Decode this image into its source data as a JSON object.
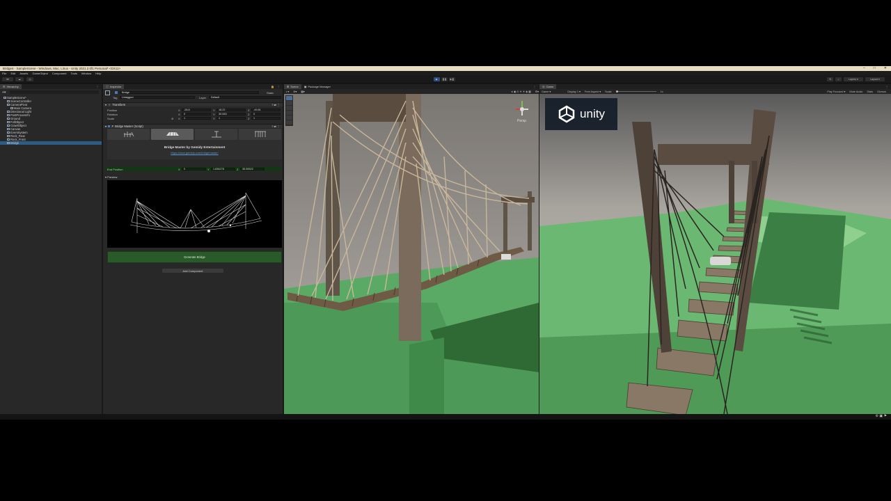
{
  "window": {
    "title": "Bridge4 - SampleScene - Windows, Mac, Linux - Unity 2021.2.0f1 Personal* <DX11>"
  },
  "menu": [
    "File",
    "Edit",
    "Assets",
    "GameObject",
    "Component",
    "Tools",
    "Window",
    "Help"
  ],
  "toolbar": {
    "layers": "Layers",
    "layout": "Layout"
  },
  "hierarchy": {
    "tab": "Hierarchy",
    "items": [
      {
        "label": "SampleScene*",
        "indent": 0
      },
      {
        "label": "SceneController",
        "indent": 1
      },
      {
        "label": "CameraPivot",
        "indent": 1
      },
      {
        "label": "Main Camera",
        "indent": 2
      },
      {
        "label": "Directional Light",
        "indent": 1
      },
      {
        "label": "PostProcessFx",
        "indent": 1
      },
      {
        "label": "Ground",
        "indent": 1
      },
      {
        "label": "FollObject",
        "indent": 1
      },
      {
        "label": "CrawlObject",
        "indent": 1
      },
      {
        "label": "Canvas",
        "indent": 1
      },
      {
        "label": "EventSystem",
        "indent": 1
      },
      {
        "label": "Rock_Rear",
        "indent": 1
      },
      {
        "label": "Rock_Front",
        "indent": 1
      },
      {
        "label": "Bridge",
        "indent": 1,
        "selected": true
      }
    ]
  },
  "inspector": {
    "tab": "Inspector",
    "object_name": "Bridge",
    "static_label": "Static",
    "tag_label": "Tag",
    "tag_value": "Untagged",
    "layer_label": "Layer",
    "layer_value": "Default",
    "transform": {
      "title": "Transform",
      "position_label": "Position",
      "rotation_label": "Rotation",
      "scale_label": "Scale",
      "position": [
        "-28.8",
        "18.22",
        "-49.81"
      ],
      "rotation": [
        "0",
        "30.083",
        "0"
      ],
      "scale": [
        "1",
        "1",
        "1"
      ]
    },
    "script": {
      "title": "Bridge Master (Script)",
      "heading": "Bridge Master by Gemidy Entertainment",
      "link": "https://www.gemidy.com/bridgemaster/",
      "end_position_label": "End Position",
      "end_position": [
        "0",
        "1.836278",
        "35.55522"
      ]
    },
    "preview_label": "Preview",
    "generate_button": "Generate Bridge",
    "add_component": "Add Component"
  },
  "scene": {
    "tabs": [
      "Scene",
      "Package Manager"
    ],
    "persp": "Persp"
  },
  "game": {
    "tab": "Game",
    "mode": "Game",
    "display": "Display 1",
    "aspect": "Free Aspect",
    "scale_label": "Scale",
    "scale_value": "1x",
    "play_focused": "Play Focused",
    "mute": "Mute Audio",
    "stats": "Stats",
    "gizmos": "Gizmos",
    "logo_text": "unity"
  },
  "colors": {
    "accent": "#2c5d87",
    "ground": "#5aaa66",
    "sky": "#b4b0aa",
    "generate": "#2a5a2a"
  }
}
